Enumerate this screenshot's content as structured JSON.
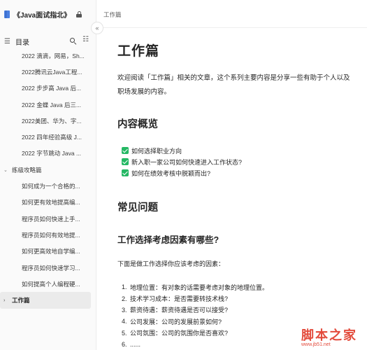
{
  "sidebar": {
    "book_title": "《Java面试指北》",
    "toc_label": "目录",
    "items": [
      {
        "label": "2022 滴滴，网易，Sh...",
        "type": "child"
      },
      {
        "label": "2022腾讯云Java工程...",
        "type": "child"
      },
      {
        "label": "2022 步步高 Java 后...",
        "type": "child"
      },
      {
        "label": "2022 金蝶 Java 后三...",
        "type": "child"
      },
      {
        "label": "2022美团、华为、字...",
        "type": "child"
      },
      {
        "label": "2022 四年经验高级 J...",
        "type": "child"
      },
      {
        "label": "2022 字节跳动 Java ...",
        "type": "child"
      },
      {
        "label": "练级攻略篇",
        "type": "group"
      },
      {
        "label": "如何成为一个合格的...",
        "type": "child"
      },
      {
        "label": "如何更有效地提高编...",
        "type": "child"
      },
      {
        "label": "程序员如何快速上手...",
        "type": "child"
      },
      {
        "label": "程序员如何有效地提...",
        "type": "child"
      },
      {
        "label": "如何更高效地自学编...",
        "type": "child"
      },
      {
        "label": "程序员如何快速学习...",
        "type": "child"
      },
      {
        "label": "如何提高个人编程硬...",
        "type": "child"
      },
      {
        "label": "工作篇",
        "type": "group"
      }
    ]
  },
  "header": {
    "breadcrumb": "工作篇"
  },
  "article": {
    "title": "工作篇",
    "intro": "欢迎阅读「工作篇」相关的文章，这个系列主要内容是分享一些有助于个人以及职场发展的内容。",
    "overview_heading": "内容概览",
    "tasks": [
      "如何选择职业方向",
      "新入职一家公司如何快速进入工作状态?",
      "如何在绩效考核中脱颖而出?"
    ],
    "faq_heading": "常见问题",
    "factors_heading": "工作选择考虑因素有哪些?",
    "factors_intro": "下面是做工作选择你应该考虑的因素：",
    "factors": [
      {
        "num": "1.",
        "text": "地理位置：有对象的话需要考虑对象的地理位置。"
      },
      {
        "num": "2.",
        "text": "技术学习成本：是否需要转技术栈?"
      },
      {
        "num": "3.",
        "text": "薪资待遇：薪资待遇是否可以接受?"
      },
      {
        "num": "4.",
        "text": "公司发展：公司的发展前景如何?"
      },
      {
        "num": "5.",
        "text": "公司氛围：公司的氛围你是否喜欢?"
      },
      {
        "num": "6.",
        "text": "......"
      }
    ]
  },
  "watermark": {
    "text": "脚本之家",
    "url": "www.jb51.net"
  },
  "colors": {
    "accent": "#4a7fe0",
    "check": "#25b864",
    "watermark": "#e34b3c"
  }
}
